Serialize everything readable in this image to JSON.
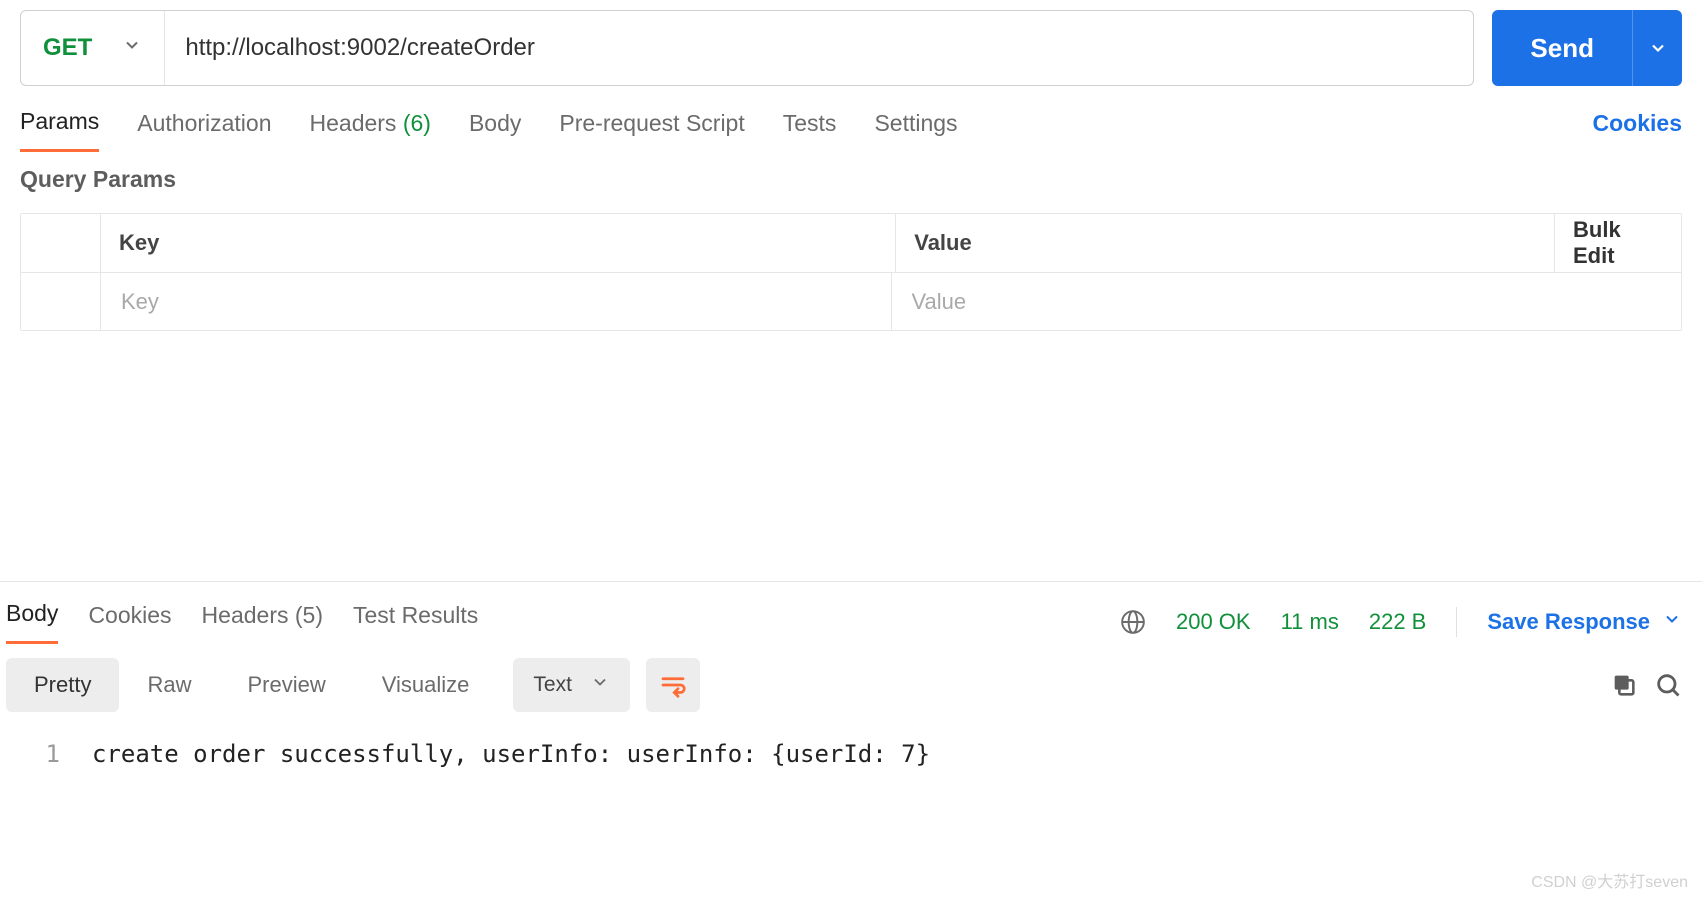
{
  "request": {
    "method": "GET",
    "url": "http://localhost:9002/createOrder",
    "send_label": "Send"
  },
  "tabs": {
    "params": "Params",
    "authorization": "Authorization",
    "headers_label": "Headers",
    "headers_count": "(6)",
    "body": "Body",
    "prereq": "Pre-request Script",
    "tests": "Tests",
    "settings": "Settings",
    "cookies_link": "Cookies"
  },
  "query_params": {
    "title": "Query Params",
    "key_header": "Key",
    "value_header": "Value",
    "bulk_edit": "Bulk Edit",
    "key_placeholder": "Key",
    "value_placeholder": "Value"
  },
  "response": {
    "tabs": {
      "body": "Body",
      "cookies": "Cookies",
      "headers_label": "Headers",
      "headers_count": "(5)",
      "test_results": "Test Results"
    },
    "status_code": "200 OK",
    "time": "11 ms",
    "size": "222 B",
    "save_label": "Save Response",
    "view": {
      "pretty": "Pretty",
      "raw": "Raw",
      "preview": "Preview",
      "visualize": "Visualize",
      "format": "Text"
    },
    "body_lines": [
      {
        "n": "1",
        "text": "create order successfully, userInfo: userInfo: {userId: 7}"
      }
    ]
  },
  "watermark": "CSDN @大苏打seven"
}
